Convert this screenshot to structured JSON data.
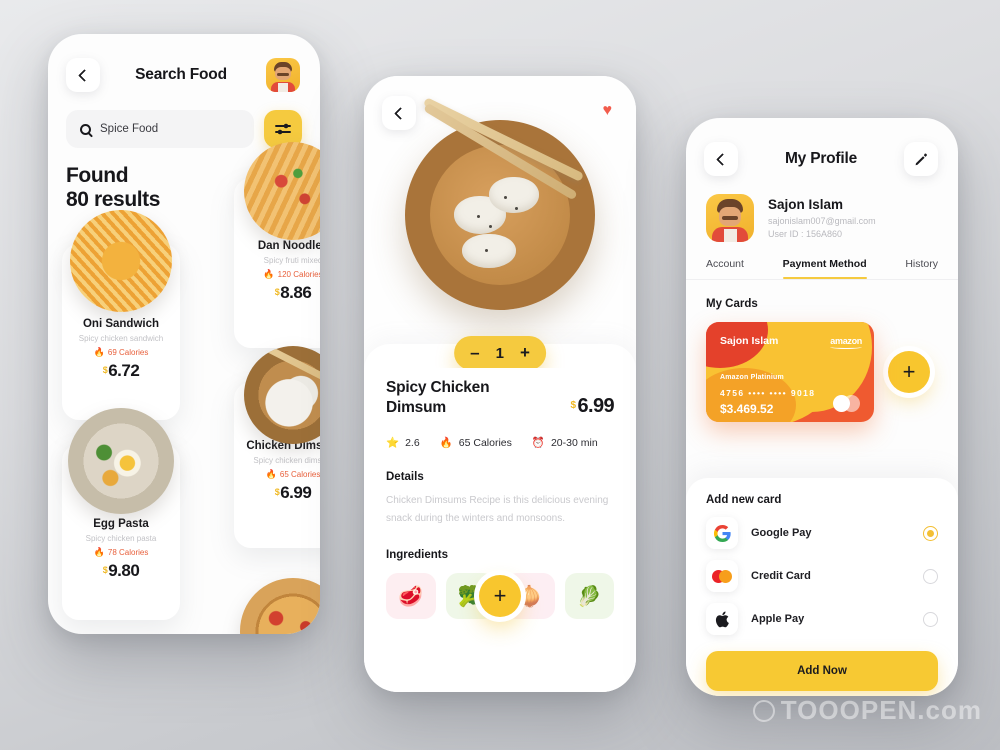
{
  "watermark": "TOOOPEN.com",
  "colors": {
    "accent": "#F5CA3F",
    "accent_deep": "#F8C62E",
    "card_red": "#F05A33",
    "card_yellow": "#F9C233",
    "calorie_text": "#E8603C",
    "muted": "#C2C2C6"
  },
  "search_screen": {
    "title": "Search Food",
    "back_icon": "chevron-left-icon",
    "avatar_icon": "user-avatar",
    "search": {
      "value": "Spice Food",
      "placeholder": "Spice Food",
      "icon": "search-icon"
    },
    "filter_icon": "filter-sliders-icon",
    "found_line1": "Found",
    "found_line2": "80 results",
    "items": [
      {
        "name": "Oni Sandwich",
        "subtitle": "Spicy chicken sandwich",
        "calories": "69 Calories",
        "currency": "$",
        "price": "6.72",
        "image": "sandwich"
      },
      {
        "name": "Dan Noodles",
        "subtitle": "Spicy fruti mixed",
        "calories": "120 Calories",
        "currency": "$",
        "price": "8.86",
        "image": "noodles"
      },
      {
        "name": "Chicken Dimsum",
        "subtitle": "Spicy chicken dimsum",
        "calories": "65 Calories",
        "currency": "$",
        "price": "6.99",
        "image": "dimsum"
      },
      {
        "name": "Egg Pasta",
        "subtitle": "Spicy chicken pasta",
        "calories": "78 Calories",
        "currency": "$",
        "price": "9.80",
        "image": "eggpasta"
      }
    ]
  },
  "detail_screen": {
    "back_icon": "chevron-left-icon",
    "favorite_icon": "heart-icon",
    "quantity": {
      "minus": "–",
      "value": "1",
      "plus": "+"
    },
    "title": "Spicy Chicken Dimsum",
    "currency": "$",
    "price": "6.99",
    "meta": [
      {
        "icon": "star-icon",
        "glyph": "⭐",
        "label": "2.6"
      },
      {
        "icon": "flame-icon",
        "glyph": "🔥",
        "label": "65 Calories"
      },
      {
        "icon": "alarm-clock-icon",
        "glyph": "⏰",
        "label": "20-30 min"
      }
    ],
    "details_heading": "Details",
    "details_text": "Chicken Dimsums Recipe is this delicious evening snack during the winters and monsoons.",
    "ingredients_heading": "Ingredients",
    "ingredients": [
      {
        "name": "meat",
        "glyph": "🥩"
      },
      {
        "name": "broccoli",
        "glyph": "🥦"
      },
      {
        "name": "onion",
        "glyph": "🧅"
      },
      {
        "name": "cabbage",
        "glyph": "🥬"
      }
    ],
    "add_ingredient_icon": "plus-icon"
  },
  "profile_screen": {
    "title": "My Profile",
    "back_icon": "chevron-left-icon",
    "edit_icon": "pencil-icon",
    "user": {
      "name": "Sajon Islam",
      "email": "sajonislam007@gmail.com",
      "user_id": "User ID : 156A860",
      "avatar_icon": "user-avatar"
    },
    "tabs": [
      {
        "label": "Account",
        "active": false
      },
      {
        "label": "Payment Method",
        "active": true
      },
      {
        "label": "History",
        "active": false
      }
    ],
    "my_cards_heading": "My Cards",
    "card": {
      "holder": "Sajon Islam",
      "brand": "amazon",
      "type": "Amazon Platinium",
      "number_prefix": "4756",
      "number_mask": "••••  ••••",
      "number_suffix": "9018",
      "balance": "$3.469.52",
      "network_icon": "mastercard-icon"
    },
    "add_card_icon": "plus-icon",
    "add_new_card_heading": "Add new card",
    "payment_methods": [
      {
        "label": "Google Pay",
        "icon": "google-pay-icon",
        "selected": true
      },
      {
        "label": "Credit Card",
        "icon": "mastercard-icon",
        "selected": false
      },
      {
        "label": "Apple Pay",
        "icon": "apple-pay-icon",
        "selected": false
      }
    ],
    "add_now_button": "Add Now"
  }
}
